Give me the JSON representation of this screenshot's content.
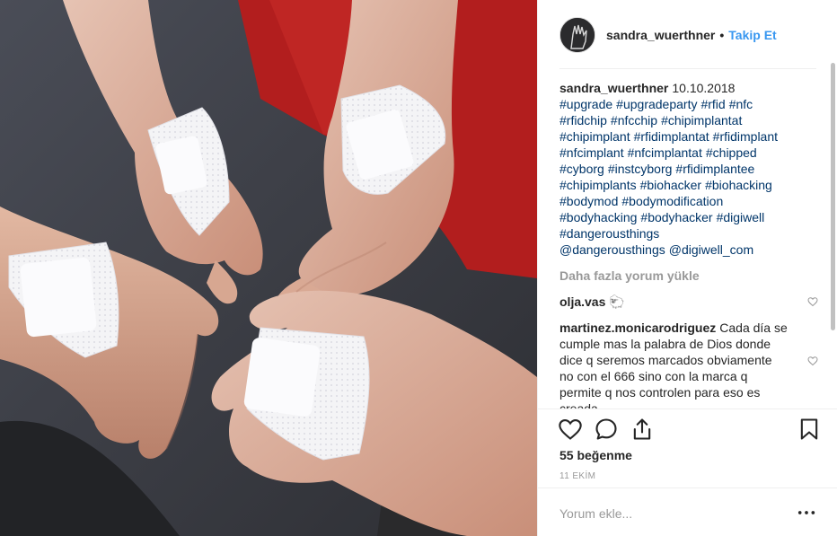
{
  "photo": {
    "alt_icon": "photo-of-bandaged-hands"
  },
  "header": {
    "username": "sandra_wuerthner",
    "separator": "•",
    "follow_label": "Takip Et"
  },
  "caption": {
    "username": "sandra_wuerthner",
    "date": "10.10.2018",
    "hashtags": [
      "#upgrade",
      "#upgradeparty",
      "#rfid",
      "#nfc",
      "#rfidchip",
      "#nfcchip",
      "#chipimplantat",
      "#chipimplant",
      "#rfidimplantat",
      "#rfidimplant",
      "#nfcimplant",
      "#nfcimplantat",
      "#chipped",
      "#cyborg",
      "#instcyborg",
      "#rfidimplantee",
      "#chipimplants",
      "#biohacker",
      "#biohacking",
      "#bodymod",
      "#bodymodification",
      "#bodyhacking",
      "#bodyhacker",
      "#digiwell",
      "#dangerousthings",
      "@dangerousthings",
      "@digiwell_com"
    ]
  },
  "load_more_label": "Daha fazla yorum yükle",
  "comments": [
    {
      "user": "olja.vas",
      "text": "🐑"
    },
    {
      "user": "martinez.monicarodriguez",
      "text": "Cada día se cumple mas la palabra de Dios donde dice q seremos marcados obviamente no con el 666 sino con la marca q permite q nos controlen para eso es creada"
    }
  ],
  "likes_label": "55 beğenme",
  "date_label": "11 EKİM",
  "add_comment": {
    "placeholder": "Yorum ekle..."
  },
  "colors": {
    "link": "#003569",
    "follow": "#3897f0",
    "muted": "#999999"
  }
}
